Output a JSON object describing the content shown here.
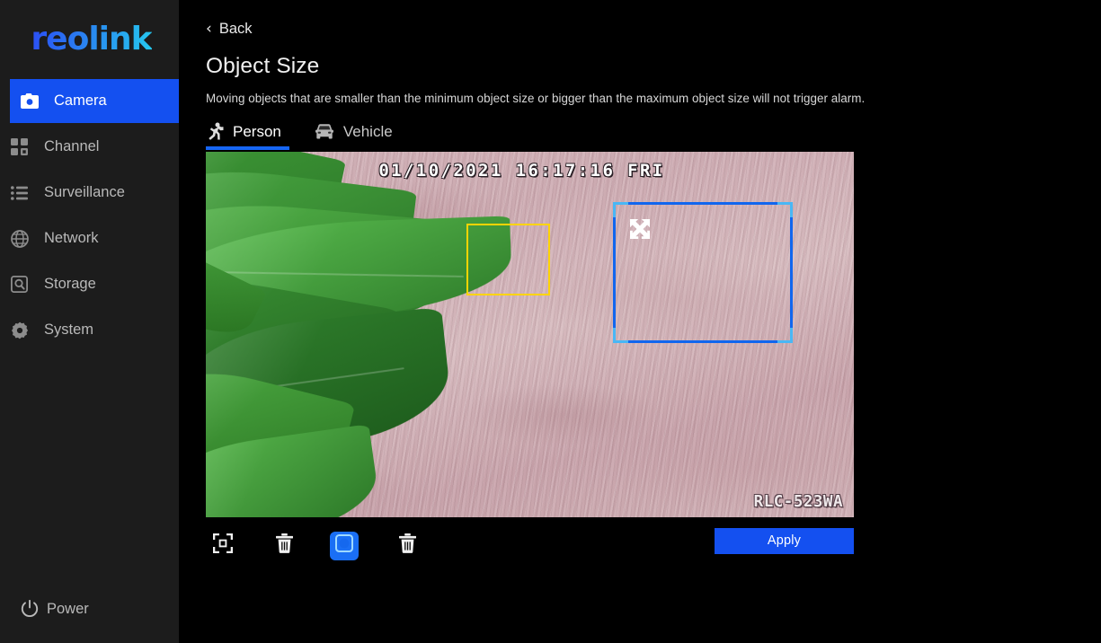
{
  "brand": {
    "logo_text": "reolink"
  },
  "sidebar": {
    "items": [
      {
        "label": "Camera",
        "icon": "camera-icon",
        "active": true
      },
      {
        "label": "Channel",
        "icon": "grid-icon",
        "active": false
      },
      {
        "label": "Surveillance",
        "icon": "list-icon",
        "active": false
      },
      {
        "label": "Network",
        "icon": "globe-icon",
        "active": false
      },
      {
        "label": "Storage",
        "icon": "hard-drive-icon",
        "active": false
      },
      {
        "label": "System",
        "icon": "gear-icon",
        "active": false
      }
    ],
    "power": {
      "label": "Power",
      "icon": "power-icon"
    }
  },
  "header": {
    "back_label": "Back",
    "back_icon": "chevron-left-icon",
    "title": "Object Size",
    "description": "Moving objects that are smaller than the minimum object size or bigger than the maximum object size will not trigger alarm."
  },
  "tabs": [
    {
      "label": "Person",
      "icon": "running-person-icon",
      "active": true
    },
    {
      "label": "Vehicle",
      "icon": "car-icon",
      "active": false
    }
  ],
  "video": {
    "timestamp": "01/10/2021 16:17:16 FRI",
    "watermark": "RLC-523WA",
    "min_box": {
      "name": "minimum-object-size-box",
      "color": "#ffd400"
    },
    "max_box": {
      "name": "maximum-object-size-box",
      "color": "#1166ee",
      "corner_color": "#49b7f5",
      "handle_icon": "resize-arrows-icon"
    }
  },
  "toolbar": {
    "buttons": [
      {
        "name": "draw-min-size-icon",
        "icon": "min-size-icon",
        "selected": false
      },
      {
        "name": "delete-min-size",
        "icon": "trash-icon",
        "selected": false
      },
      {
        "name": "draw-max-size-icon",
        "icon": "max-size-icon",
        "selected": true
      },
      {
        "name": "delete-max-size",
        "icon": "trash-icon",
        "selected": false
      }
    ],
    "apply_label": "Apply"
  },
  "colors": {
    "accent_blue": "#1450f0",
    "selected_blue": "#1a6ff5",
    "sidebar_bg": "#1c1c1c",
    "page_bg": "#000000",
    "min_box_yellow": "#ffd400",
    "max_box_blue": "#1166ee"
  }
}
